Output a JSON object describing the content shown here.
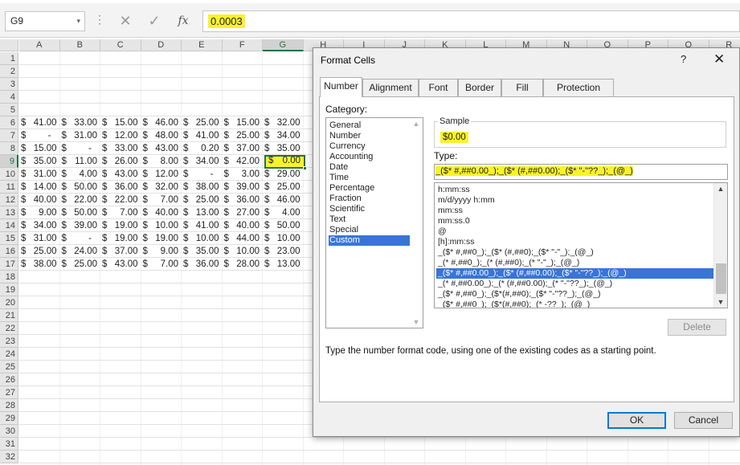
{
  "formula_bar": {
    "name_box": "G9",
    "name_box_arrow": "▾",
    "dots": "⋮",
    "cancel_icon": "✕",
    "enter_icon": "✓",
    "fx_label": "fx",
    "formula": "0.0003"
  },
  "sheet": {
    "columns": [
      "A",
      "B",
      "C",
      "D",
      "E",
      "F",
      "G",
      "H",
      "I",
      "J",
      "K",
      "L",
      "M",
      "N",
      "O",
      "P",
      "Q",
      "R"
    ],
    "selected_column": "G",
    "rows": [
      "1",
      "2",
      "3",
      "4",
      "5",
      "6",
      "7",
      "8",
      "9",
      "10",
      "11",
      "12",
      "13",
      "14",
      "15",
      "16",
      "17",
      "18",
      "19",
      "20",
      "21",
      "22",
      "23",
      "24",
      "25",
      "26",
      "27",
      "28",
      "29",
      "30",
      "31",
      "32"
    ],
    "selected_row": "9",
    "currency_symbol": "$",
    "data": [
      [
        "41.00",
        "33.00",
        "15.00",
        "46.00",
        "25.00",
        "15.00",
        "32.00"
      ],
      [
        "-",
        "31.00",
        "12.00",
        "48.00",
        "41.00",
        "25.00",
        "34.00"
      ],
      [
        "15.00",
        "-",
        "33.00",
        "43.00",
        "0.20",
        "37.00",
        "35.00"
      ],
      [
        "35.00",
        "11.00",
        "26.00",
        "8.00",
        "34.00",
        "42.00",
        "0.00"
      ],
      [
        "31.00",
        "4.00",
        "43.00",
        "12.00",
        "-",
        "3.00",
        "29.00"
      ],
      [
        "14.00",
        "50.00",
        "36.00",
        "32.00",
        "38.00",
        "39.00",
        "25.00"
      ],
      [
        "40.00",
        "22.00",
        "22.00",
        "7.00",
        "25.00",
        "36.00",
        "46.00"
      ],
      [
        "9.00",
        "50.00",
        "7.00",
        "40.00",
        "13.00",
        "27.00",
        "4.00"
      ],
      [
        "34.00",
        "39.00",
        "19.00",
        "10.00",
        "41.00",
        "40.00",
        "50.00"
      ],
      [
        "31.00",
        "-",
        "19.00",
        "19.00",
        "10.00",
        "44.00",
        "10.00"
      ],
      [
        "25.00",
        "24.00",
        "37.00",
        "9.00",
        "35.00",
        "10.00",
        "23.00"
      ],
      [
        "38.00",
        "25.00",
        "43.00",
        "7.00",
        "36.00",
        "28.00",
        "13.00"
      ]
    ]
  },
  "dialog": {
    "title": "Format Cells",
    "help_icon": "?",
    "close_icon": "✕",
    "tabs": [
      "Number",
      "Alignment",
      "Font",
      "Border",
      "Fill",
      "Protection"
    ],
    "active_tab": "Number",
    "category_label": "Category:",
    "categories": [
      "General",
      "Number",
      "Currency",
      "Accounting",
      "Date",
      "Time",
      "Percentage",
      "Fraction",
      "Scientific",
      "Text",
      "Special",
      "Custom"
    ],
    "selected_category": "Custom",
    "sample_label": "Sample",
    "sample_value": "$0.00",
    "type_label": "Type:",
    "type_value": "_($* #,##0.00_);_($* (#,##0.00);_($* \"-\"??_);_(@_)",
    "type_list": [
      "h:mm:ss",
      "m/d/yyyy h:mm",
      "mm:ss",
      "mm:ss.0",
      "@",
      "[h]:mm:ss",
      "_($* #,##0_);_($* (#,##0);_($* \"-\"_);_(@_)",
      "_(* #,##0_);_(* (#,##0);_(* \"-\"_);_(@_)",
      "_($* #,##0.00_);_($* (#,##0.00);_($* \"-\"??_);_(@_)",
      "_(* #,##0.00_);_(* (#,##0.00);_(* \"-\"??_);_(@_)",
      "_($* #,##0_);_($*(#,##0);_($* \"-\"??_);_(@_)",
      "_($* #,##0_);_($*(#,##0);_(* -??_);_(@_)"
    ],
    "selected_type_index": 8,
    "scroll_up": "▲",
    "scroll_down": "▼",
    "delete_button": "Delete",
    "help_text": "Type the number format code, using one of the existing codes as a starting point.",
    "ok_button": "OK",
    "cancel_button": "Cancel",
    "highlight_color": "#f9f22b",
    "selection_color": "#3875d7",
    "excel_green": "#217346"
  }
}
